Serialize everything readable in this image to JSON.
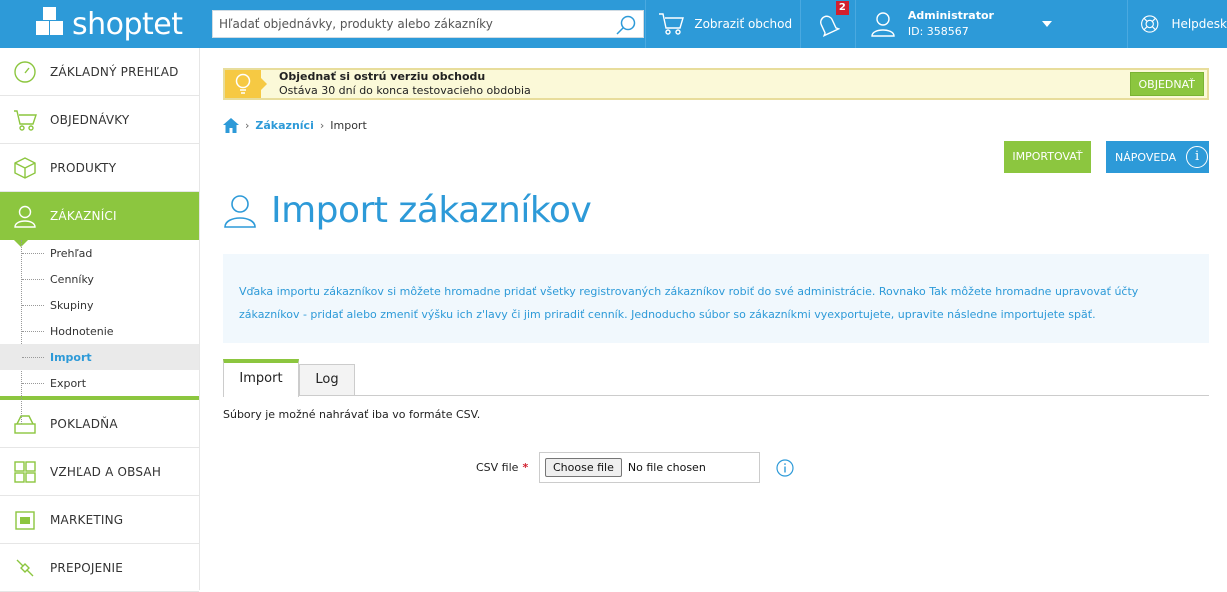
{
  "brand": {
    "name": "shoptet",
    "primary": "#2d9ad8",
    "green": "#8cc63f"
  },
  "topbar": {
    "search_placeholder": "Hľadať objednávky, produkty alebo zákazníky",
    "shop_label": "Zobraziť obchod",
    "notifications_count": "2",
    "admin_name": "Administrator",
    "admin_id": "ID: 358567",
    "help_label": "Helpdesk"
  },
  "sidebar": {
    "items": [
      {
        "label": "ZÁKLADNÝ PREHĽAD",
        "icon": "dashboard-icon"
      },
      {
        "label": "OBJEDNÁVKY",
        "icon": "cart-icon"
      },
      {
        "label": "PRODUKTY",
        "icon": "box-icon"
      },
      {
        "label": "ZÁKAZNÍCI",
        "icon": "user-icon"
      },
      {
        "label": "POKLADŇA",
        "icon": "register-icon"
      },
      {
        "label": "VZHĽAD A OBSAH",
        "icon": "layout-icon"
      },
      {
        "label": "MARKETING",
        "icon": "megaphone-icon"
      },
      {
        "label": "PREPOJENIE",
        "icon": "plug-icon"
      }
    ],
    "subitems": [
      "Prehľad",
      "Cenníky",
      "Skupiny",
      "Hodnotenie",
      "Import",
      "Export"
    ]
  },
  "banner": {
    "title": "Objednať si ostrú verziu obchodu",
    "text": "Ostáva 30 dní do konca testovacieho obdobia",
    "button": "OBJEDNAŤ"
  },
  "breadcrumb": {
    "link": "Zákazníci",
    "current": "Import"
  },
  "actions": {
    "import": "IMPORTOVAŤ",
    "help": "NÁPOVEDA",
    "help_icon": "i"
  },
  "page": {
    "title": "Import zákazníkov",
    "info": "Vďaka importu zákazníkov si môžete hromadne pridať všetky registrovaných zákazníkov robiť do své administrácie. Rovnako Tak môžete hromadne upravovať účty zákazníkov - pridať alebo zmeniť výšku ich z'lavy či jim priradiť cenník. Jednoducho súbor so zákazníkmi vyexportujete, upravite následne importujete späť."
  },
  "tabs": [
    "Import",
    "Log"
  ],
  "form": {
    "note": "Súbory je možné nahrávať iba vo formáte CSV.",
    "label": "CSV file",
    "required_mark": "*",
    "file_button": "Choose file",
    "file_status": "No file chosen"
  }
}
